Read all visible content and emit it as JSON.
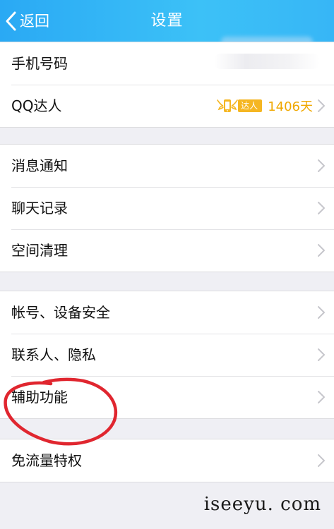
{
  "header": {
    "back_label": "返回",
    "title": "设置"
  },
  "groups": [
    {
      "items": [
        {
          "label": "手机号码"
        },
        {
          "label": "QQ达人",
          "badge_text": "达人",
          "days": "1406天"
        }
      ]
    },
    {
      "items": [
        {
          "label": "消息通知"
        },
        {
          "label": "聊天记录"
        },
        {
          "label": "空间清理"
        }
      ]
    },
    {
      "items": [
        {
          "label": "帐号、设备安全"
        },
        {
          "label": "联系人、隐私"
        },
        {
          "label": "辅助功能"
        }
      ]
    },
    {
      "items": [
        {
          "label": "免流量特权"
        }
      ]
    }
  ],
  "watermark": "iseeyu. com",
  "colors": {
    "header_bg": "#2aa9f4",
    "background": "#efeff4",
    "badge": "#f5b622",
    "days_text": "#f0a800",
    "annotation": "#e0262f"
  },
  "icons": [
    "chevron-left-icon",
    "chevron-right-icon",
    "phone-wings-icon"
  ]
}
